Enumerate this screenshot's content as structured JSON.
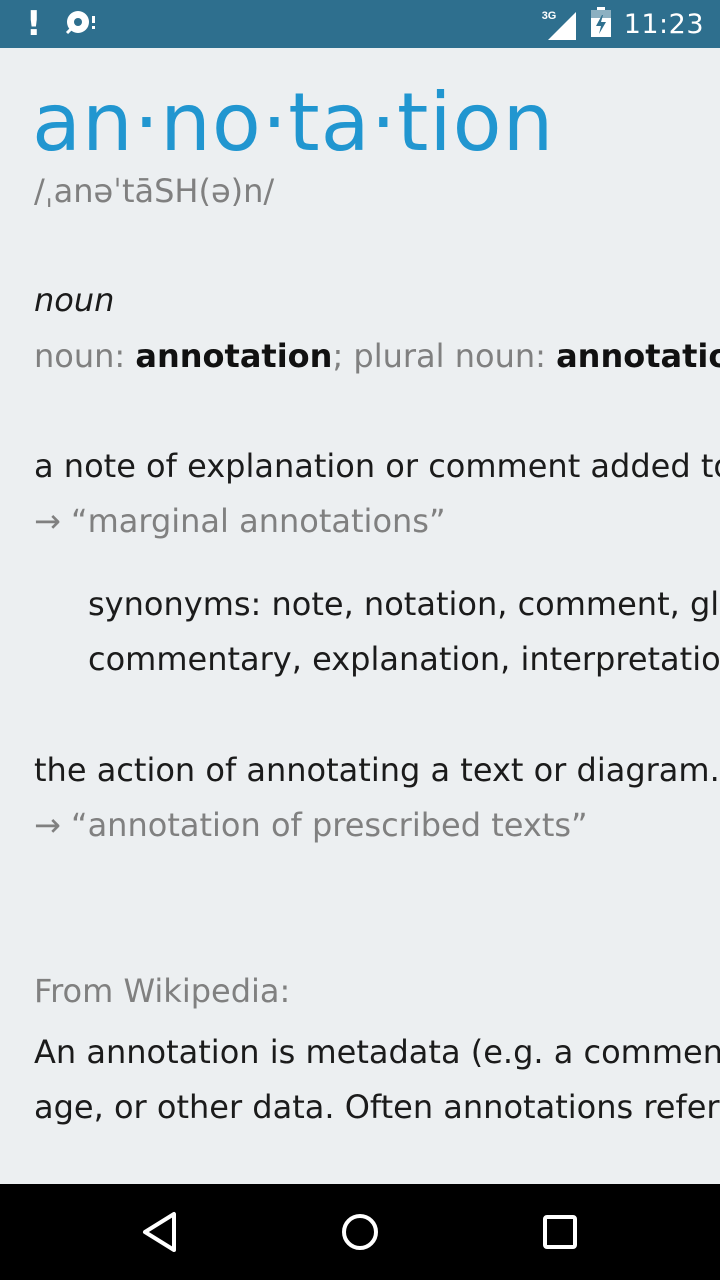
{
  "status_bar": {
    "network_type": "3G",
    "time": "11:23",
    "icons": [
      "alert-icon",
      "sync-icon",
      "signal-icon",
      "battery-charging-icon"
    ]
  },
  "entry": {
    "headword": "an·no·ta·tion",
    "phonetic": "/ˌanəˈtāSH(ə)n/",
    "part_of_speech": "noun",
    "forms": {
      "label_noun": "noun: ",
      "noun": "annotation",
      "separator": "; ",
      "label_plural": "plural noun: ",
      "plural": "annotations"
    },
    "definitions": [
      {
        "text": "a note of explanation or comment added to a text or diagram.",
        "example": "→ “marginal annotations”",
        "synonyms_line1": "synonyms: note, notation, comment, gloss,",
        "synonyms_line2": "commentary, explanation, interpretation"
      },
      {
        "text": "the action of annotating a text or diagram.",
        "example": "→ “annotation of prescribed texts”"
      }
    ]
  },
  "wikipedia": {
    "label": "From Wikipedia:",
    "line1": "An annotation is metadata (e.g. a comment,",
    "line2": "age, or other data. Often annotations refer to"
  },
  "colors": {
    "status_bar": "#2e6f8e",
    "headword": "#2196d0",
    "background": "#eceff1",
    "muted_text": "#808080",
    "nav_bar": "#000000"
  },
  "nav_bar": {
    "icons": [
      "back-icon",
      "home-icon",
      "recents-icon"
    ]
  }
}
